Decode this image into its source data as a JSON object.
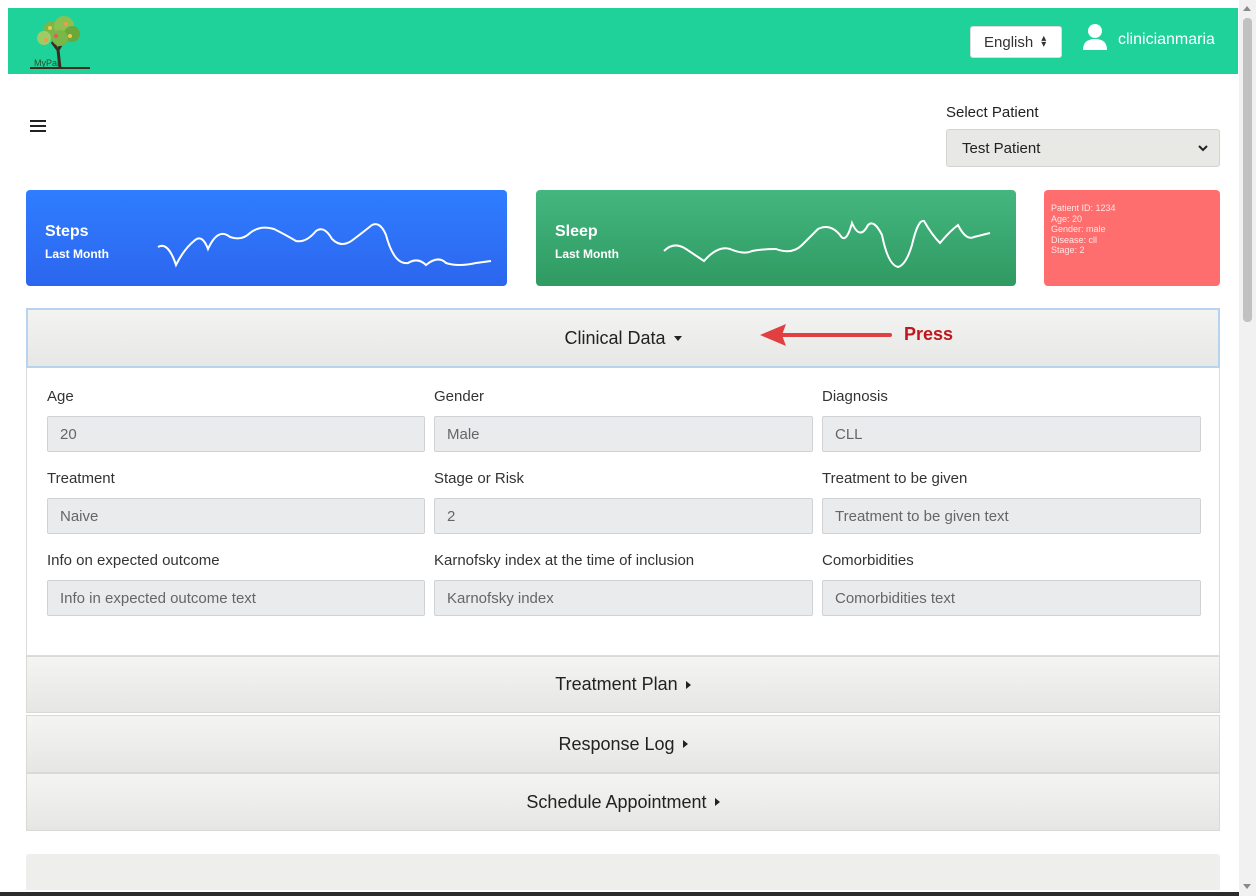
{
  "header": {
    "logo_text": "MyPal",
    "language": "English",
    "username": "clinicianmaria"
  },
  "patient_selector": {
    "label": "Select Patient",
    "selected": "Test Patient"
  },
  "cards": {
    "steps": {
      "title": "Steps",
      "subtitle": "Last Month"
    },
    "sleep": {
      "title": "Sleep",
      "subtitle": "Last Month"
    },
    "info": {
      "lines": [
        "Patient ID: 1234",
        "Age: 20",
        "Gender: male",
        "Disease: cll",
        "Stage: 2"
      ]
    }
  },
  "accordion": {
    "clinical": {
      "title": "Clinical Data",
      "fields": [
        {
          "label": "Age",
          "value": "20"
        },
        {
          "label": "Gender",
          "value": "Male"
        },
        {
          "label": "Diagnosis",
          "value": "CLL"
        },
        {
          "label": "Treatment",
          "value": "Naive"
        },
        {
          "label": "Stage or Risk",
          "value": "2"
        },
        {
          "label": "Treatment to be given",
          "value": "Treatment to be given text"
        },
        {
          "label": "Info on expected outcome",
          "value": "Info in expected outcome text"
        },
        {
          "label": "Karnofsky index at the time of inclusion",
          "value": "Karnofsky index"
        },
        {
          "label": "Comorbidities",
          "value": "Comorbidities text"
        }
      ]
    },
    "treatment_plan": "Treatment Plan",
    "response_log": "Response Log",
    "schedule_appointment": "Schedule Appointment"
  },
  "annotation": {
    "text": "Press",
    "color": "#c0161d"
  },
  "colors": {
    "header": "#1ed29a",
    "steps_card": "#2c66ee",
    "sleep_card": "#2f9a62",
    "info_card": "#ff6e6e"
  }
}
